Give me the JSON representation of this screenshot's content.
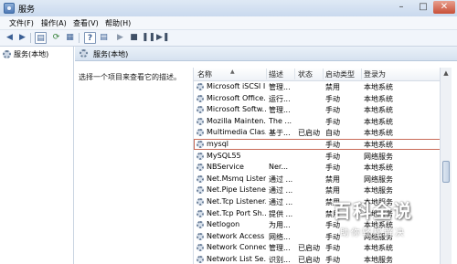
{
  "window": {
    "title": "服务"
  },
  "menu": [
    "文件(F)",
    "操作(A)",
    "查看(V)",
    "帮助(H)"
  ],
  "tree": {
    "root_label": "服务(本地)"
  },
  "panel": {
    "title": "服务(本地)",
    "description_hint": "选择一个项目来查看它的描述。"
  },
  "table": {
    "columns": [
      "名称",
      "描述",
      "状态",
      "启动类型",
      "登录为"
    ],
    "rows": [
      {
        "name": "Microsoft iSCSI I...",
        "desc": "管理...",
        "status": "",
        "startup": "禁用",
        "logon": "本地系统"
      },
      {
        "name": "Microsoft Office...",
        "desc": "运行...",
        "status": "",
        "startup": "手动",
        "logon": "本地系统"
      },
      {
        "name": "Microsoft Softw...",
        "desc": "管理...",
        "status": "",
        "startup": "手动",
        "logon": "本地系统"
      },
      {
        "name": "Mozilla Mainten...",
        "desc": "The ...",
        "status": "",
        "startup": "手动",
        "logon": "本地系统"
      },
      {
        "name": "Multimedia Clas...",
        "desc": "基于...",
        "status": "已启动",
        "startup": "自动",
        "logon": "本地系统"
      },
      {
        "name": "mysql",
        "desc": "",
        "status": "",
        "startup": "手动",
        "logon": "本地系统"
      },
      {
        "name": "MySQL55",
        "desc": "",
        "status": "",
        "startup": "手动",
        "logon": "网络服务"
      },
      {
        "name": "NBService",
        "desc": "Ner...",
        "status": "",
        "startup": "手动",
        "logon": "本地系统"
      },
      {
        "name": "Net.Msmq Listen...",
        "desc": "通过 ...",
        "status": "",
        "startup": "禁用",
        "logon": "网络服务"
      },
      {
        "name": "Net.Pipe Listene...",
        "desc": "通过 ...",
        "status": "",
        "startup": "禁用",
        "logon": "本地服务"
      },
      {
        "name": "Net.Tcp Listener...",
        "desc": "通过 ...",
        "status": "",
        "startup": "禁用",
        "logon": "本地服务"
      },
      {
        "name": "Net.Tcp Port Sh...",
        "desc": "提供 ...",
        "status": "",
        "startup": "禁用",
        "logon": "本地服务"
      },
      {
        "name": "Netlogon",
        "desc": "为用...",
        "status": "",
        "startup": "手动",
        "logon": "本地系统"
      },
      {
        "name": "Network Access ...",
        "desc": "网络...",
        "status": "",
        "startup": "手动",
        "logon": "网络服务"
      },
      {
        "name": "Network Connec...",
        "desc": "管理...",
        "status": "已启动",
        "startup": "手动",
        "logon": "本地系统"
      },
      {
        "name": "Network List Se...",
        "desc": "识别...",
        "status": "已启动",
        "startup": "手动",
        "logon": "本地服务"
      }
    ],
    "selected_index": 5
  },
  "watermark": {
    "title": "百科全说",
    "subtitle": "助你轻松解决"
  },
  "colors": {
    "selected_outline": "#c96b58",
    "titlebar": "#dfe9f5"
  }
}
